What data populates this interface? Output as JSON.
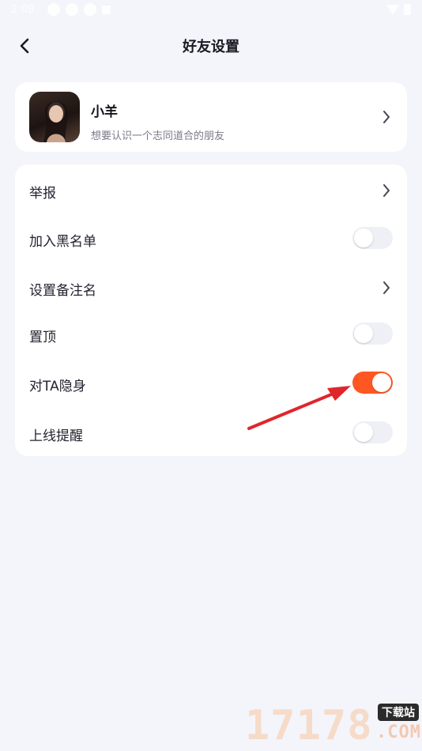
{
  "status_bar": {
    "time": "2:08"
  },
  "header": {
    "title": "好友设置"
  },
  "profile": {
    "name": "小羊",
    "signature": "想要认识一个志同道合的朋友"
  },
  "settings": [
    {
      "label": "举报",
      "control": "chevron"
    },
    {
      "label": "加入黑名单",
      "control": "toggle",
      "on": false
    },
    {
      "label": "设置备注名",
      "control": "chevron"
    },
    {
      "label": "置顶",
      "control": "toggle",
      "on": false
    },
    {
      "label": "对TA隐身",
      "control": "toggle",
      "on": true
    },
    {
      "label": "上线提醒",
      "control": "toggle",
      "on": false
    }
  ],
  "annotation": {
    "color": "#e0262b"
  },
  "watermark": {
    "digits": "17178",
    "badge": "下载站",
    "suffix": ".COM"
  },
  "colors": {
    "accent": "#ff5722",
    "background": "#f4f4fb",
    "toggle_off": "#eef0f6"
  }
}
